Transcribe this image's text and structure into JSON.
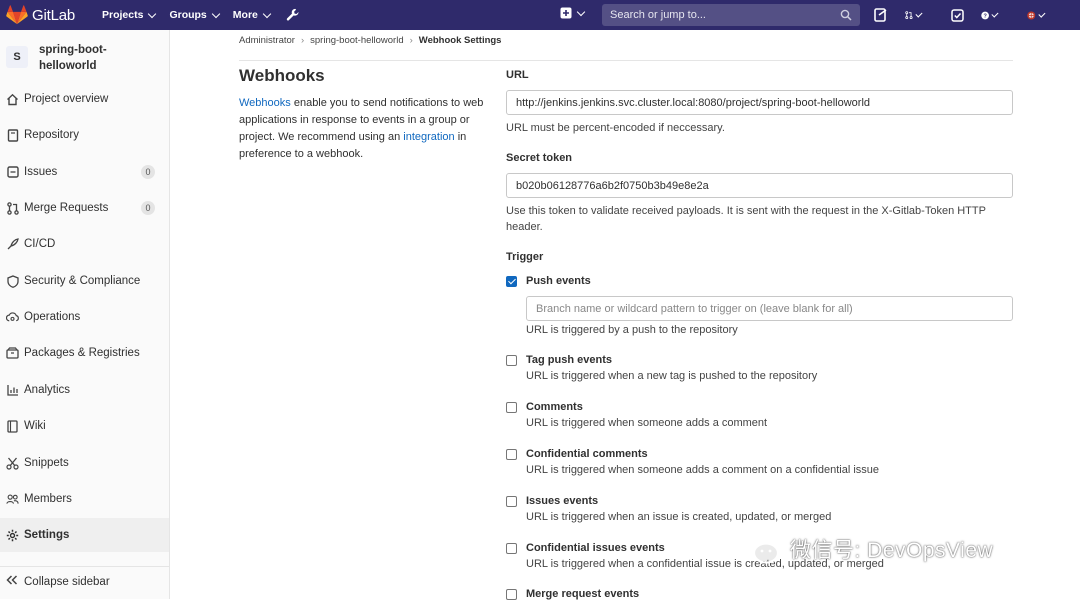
{
  "navbar": {
    "brand": "GitLab",
    "links": [
      {
        "label": "Projects"
      },
      {
        "label": "Groups"
      },
      {
        "label": "More"
      }
    ],
    "search_placeholder": "Search or jump to..."
  },
  "sidebar": {
    "project_initial": "S",
    "project_name": "spring-boot-helloworld",
    "items": [
      {
        "label": "Project overview",
        "icon": "home-icon"
      },
      {
        "label": "Repository",
        "icon": "book-icon"
      },
      {
        "label": "Issues",
        "icon": "issues-icon",
        "count": "0"
      },
      {
        "label": "Merge Requests",
        "icon": "merge-request-icon",
        "count": "0"
      },
      {
        "label": "CI/CD",
        "icon": "rocket-icon"
      },
      {
        "label": "Security & Compliance",
        "icon": "shield-icon"
      },
      {
        "label": "Operations",
        "icon": "cloud-gear-icon"
      },
      {
        "label": "Packages & Registries",
        "icon": "package-icon"
      },
      {
        "label": "Analytics",
        "icon": "chart-icon"
      },
      {
        "label": "Wiki",
        "icon": "book-page-icon"
      },
      {
        "label": "Snippets",
        "icon": "scissors-icon"
      },
      {
        "label": "Members",
        "icon": "users-icon"
      },
      {
        "label": "Settings",
        "icon": "gear-icon"
      }
    ],
    "collapse_label": "Collapse sidebar"
  },
  "breadcrumbs": [
    "Administrator",
    "spring-boot-helloworld",
    "Webhook Settings"
  ],
  "intro": {
    "title": "Webhooks",
    "link1": "Webhooks",
    "text1": " enable you to send notifications to web applications in response to events in a group or project. We recommend using an ",
    "link2": "integration",
    "text2": " in preference to a webhook."
  },
  "form": {
    "url_label": "URL",
    "url_value": "http://jenkins.jenkins.svc.cluster.local:8080/project/spring-boot-helloworld",
    "url_help": "URL must be percent-encoded if neccessary.",
    "token_label": "Secret token",
    "token_value": "b020b06128776a6b2f0750b3b49e8e2a",
    "token_help": "Use this token to validate received payloads. It is sent with the request in the X-Gitlab-Token HTTP header.",
    "trigger_label": "Trigger",
    "branch_placeholder": "Branch name or wildcard pattern to trigger on (leave blank for all)",
    "triggers": [
      {
        "title": "Push events",
        "desc": "URL is triggered by a push to the repository",
        "checked": true
      },
      {
        "title": "Tag push events",
        "desc": "URL is triggered when a new tag is pushed to the repository",
        "checked": false
      },
      {
        "title": "Comments",
        "desc": "URL is triggered when someone adds a comment",
        "checked": false
      },
      {
        "title": "Confidential comments",
        "desc": "URL is triggered when someone adds a comment on a confidential issue",
        "checked": false
      },
      {
        "title": "Issues events",
        "desc": "URL is triggered when an issue is created, updated, or merged",
        "checked": false
      },
      {
        "title": "Confidential issues events",
        "desc": "URL is triggered when a confidential issue is created, updated, or merged",
        "checked": false
      },
      {
        "title": "Merge request events",
        "desc": "",
        "checked": false
      }
    ]
  },
  "watermark": "微信号: DevOpsView",
  "colors": {
    "navbar": "#2f2a6b",
    "link": "#1068bf",
    "checkbox": "#1068bf"
  }
}
